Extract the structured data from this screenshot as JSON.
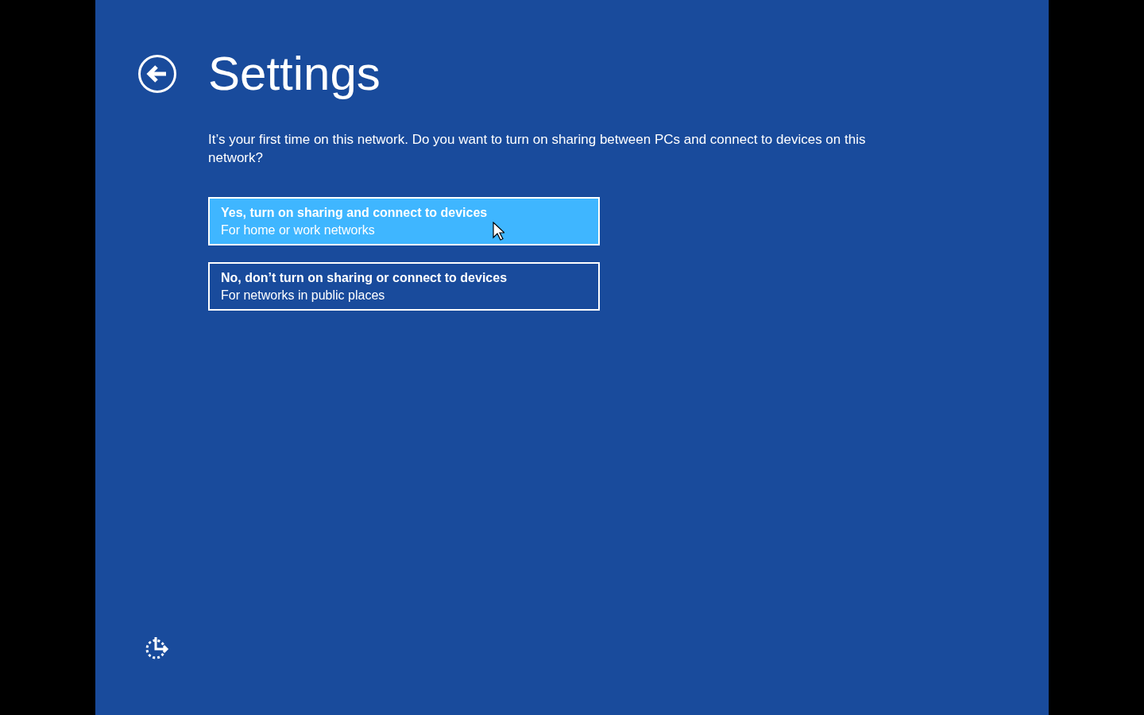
{
  "header": {
    "title": "Settings"
  },
  "prompt": "It’s your first time on this network. Do you want to turn on sharing between PCs and connect to devices on this network?",
  "options": [
    {
      "title": "Yes, turn on sharing and connect to devices",
      "subtitle": "For home or work networks",
      "selected": true
    },
    {
      "title": "No, don’t turn on sharing or connect to devices",
      "subtitle": "For networks in public places",
      "selected": false
    }
  ]
}
